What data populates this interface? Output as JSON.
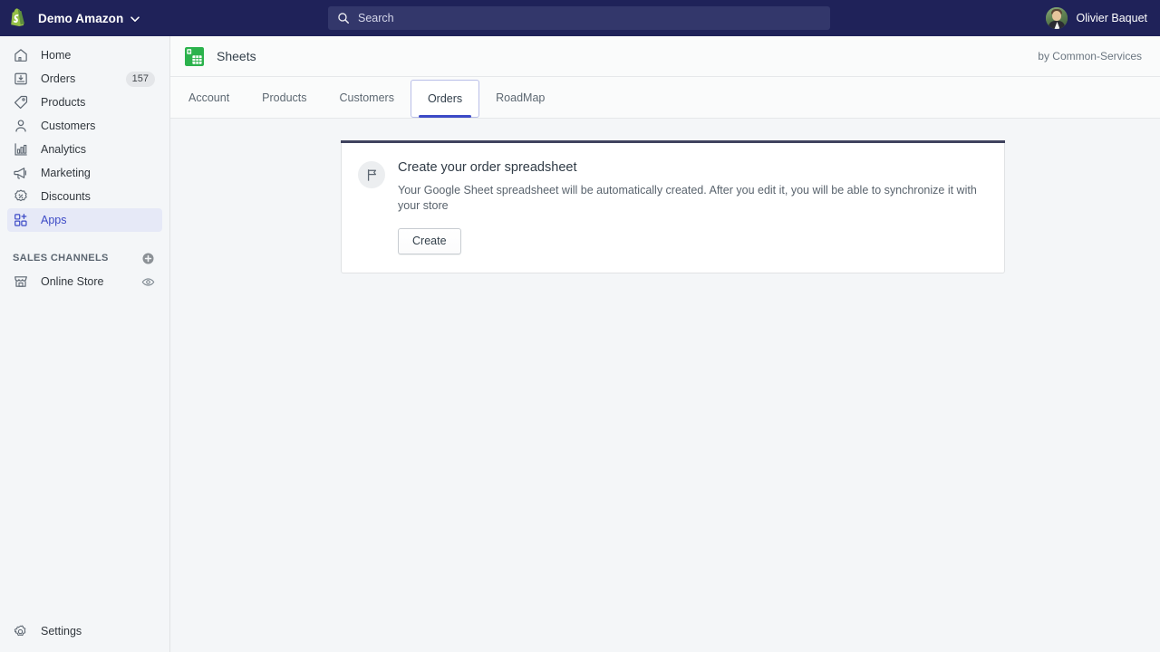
{
  "topbar": {
    "brand_name": "Demo Amazon",
    "brand_icon": "shopify-bag-icon",
    "caret_icon": "chevron-down-icon",
    "search": {
      "placeholder": "Search",
      "value": "",
      "icon": "search-icon"
    },
    "user": {
      "name": "Olivier Baquet",
      "avatar": "user-avatar"
    },
    "background_color": "#1f2259",
    "search_background_color": "#33376b"
  },
  "sidebar": {
    "items": [
      {
        "label": "Home",
        "icon": "home-icon",
        "badge": "",
        "active": false
      },
      {
        "label": "Orders",
        "icon": "orders-icon",
        "badge": "157",
        "active": false
      },
      {
        "label": "Products",
        "icon": "products-icon",
        "badge": "",
        "active": false
      },
      {
        "label": "Customers",
        "icon": "customers-icon",
        "badge": "",
        "active": false
      },
      {
        "label": "Analytics",
        "icon": "analytics-icon",
        "badge": "",
        "active": false
      },
      {
        "label": "Marketing",
        "icon": "marketing-icon",
        "badge": "",
        "active": false
      },
      {
        "label": "Discounts",
        "icon": "discounts-icon",
        "badge": "",
        "active": false
      },
      {
        "label": "Apps",
        "icon": "apps-icon",
        "badge": "",
        "active": true
      }
    ],
    "sales_channels": {
      "title": "SALES CHANNELS",
      "add_icon": "plus-circle-icon",
      "items": [
        {
          "label": "Online Store",
          "icon": "store-icon",
          "trailing_icon": "eye-icon"
        }
      ]
    },
    "settings": {
      "label": "Settings",
      "icon": "gear-icon"
    },
    "active_color": "#3c4ac6",
    "active_background": "#e6e9f7"
  },
  "app": {
    "header": {
      "icon": "google-sheets-icon",
      "title": "Sheets",
      "author": "by Common-Services"
    },
    "tabs": [
      {
        "label": "Account",
        "active": false
      },
      {
        "label": "Products",
        "active": false
      },
      {
        "label": "Customers",
        "active": false
      },
      {
        "label": "Orders",
        "active": true
      },
      {
        "label": "RoadMap",
        "active": false
      }
    ],
    "card": {
      "icon": "flag-icon",
      "title": "Create your order spreadsheet",
      "description": "Your Google Sheet spreadsheet will be automatically created. After you edit it, you will be able to synchronize it with your store",
      "button_label": "Create",
      "top_bar_color": "#40435e"
    }
  }
}
